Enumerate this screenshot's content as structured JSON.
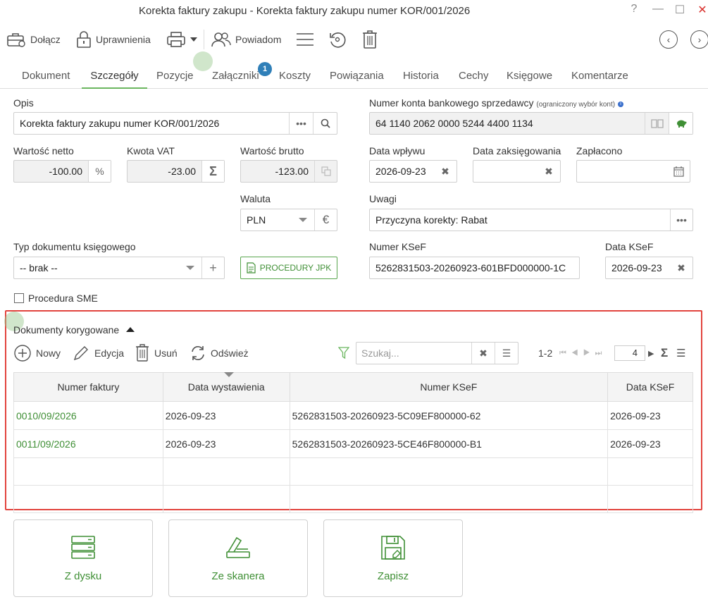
{
  "window": {
    "title": "Korekta faktury zakupu - Korekta faktury zakupu numer KOR/001/2026",
    "help": "?",
    "minimize": "—",
    "maximize": "☐",
    "close": "✕"
  },
  "toolbar": {
    "attach": "Dołącz",
    "permissions": "Uprawnienia",
    "notify": "Powiadom"
  },
  "tabs": [
    "Dokument",
    "Szczegóły",
    "Pozycje",
    "Załączniki",
    "Koszty",
    "Powiązania",
    "Historia",
    "Cechy",
    "Księgowe",
    "Komentarze"
  ],
  "attachments_badge": "1",
  "form": {
    "opis_label": "Opis",
    "opis_value": "Korekta faktury zakupu numer KOR/001/2026",
    "konto_label": "Numer konta bankowego sprzedawcy",
    "konto_note": "(ograniczony wybór kont)",
    "konto_value": "64 1140 2062 0000 5244 4400 1134",
    "netto_label": "Wartość netto",
    "netto_value": "-100.00",
    "netto_btn": "%",
    "vat_label": "Kwota VAT",
    "vat_value": "-23.00",
    "vat_btn": "Σ",
    "brutto_label": "Wartość brutto",
    "brutto_value": "-123.00",
    "wplyw_label": "Data wpływu",
    "wplyw_value": "2026-09-23",
    "zaksieg_label": "Data zaksięgowania",
    "zaksieg_value": "",
    "zaplacono_label": "Zapłacono",
    "zaplacono_value": "",
    "waluta_label": "Waluta",
    "waluta_value": "PLN",
    "waluta_btn": "€",
    "uwagi_label": "Uwagi",
    "uwagi_value": "Przyczyna korekty: Rabat",
    "typ_label": "Typ dokumentu księgowego",
    "typ_value": "-- brak --",
    "procedury_label": "PROCEDURY JPK",
    "ksef_label": "Numer KSeF",
    "ksef_value": "5262831503-20260923-601BFD000000-1C",
    "data_ksef_label": "Data KSeF",
    "data_ksef_value": "2026-09-23",
    "sme_label": "Procedura SME"
  },
  "section": {
    "title": "Dokumenty korygowane",
    "new": "Nowy",
    "edit": "Edycja",
    "delete": "Usuń",
    "refresh": "Odśwież",
    "search_placeholder": "Szukaj...",
    "range": "1-2",
    "page_size": "4",
    "columns": [
      "Numer faktury",
      "Data wystawienia",
      "Numer KSeF",
      "Data KSeF"
    ],
    "rows": [
      [
        "0010/09/2026",
        "2026-09-23",
        "5262831503-20260923-5C09EF800000-62",
        "2026-09-23"
      ],
      [
        "0011/09/2026",
        "2026-09-23",
        "5262831503-20260923-5CE46F800000-B1",
        "2026-09-23"
      ]
    ]
  },
  "actions": {
    "disk": "Z dysku",
    "scanner": "Ze skanera",
    "save": "Zapisz"
  },
  "colors": {
    "accent": "#3f8f35",
    "highlight": "#e2443e",
    "badge": "#2f7fb8"
  }
}
